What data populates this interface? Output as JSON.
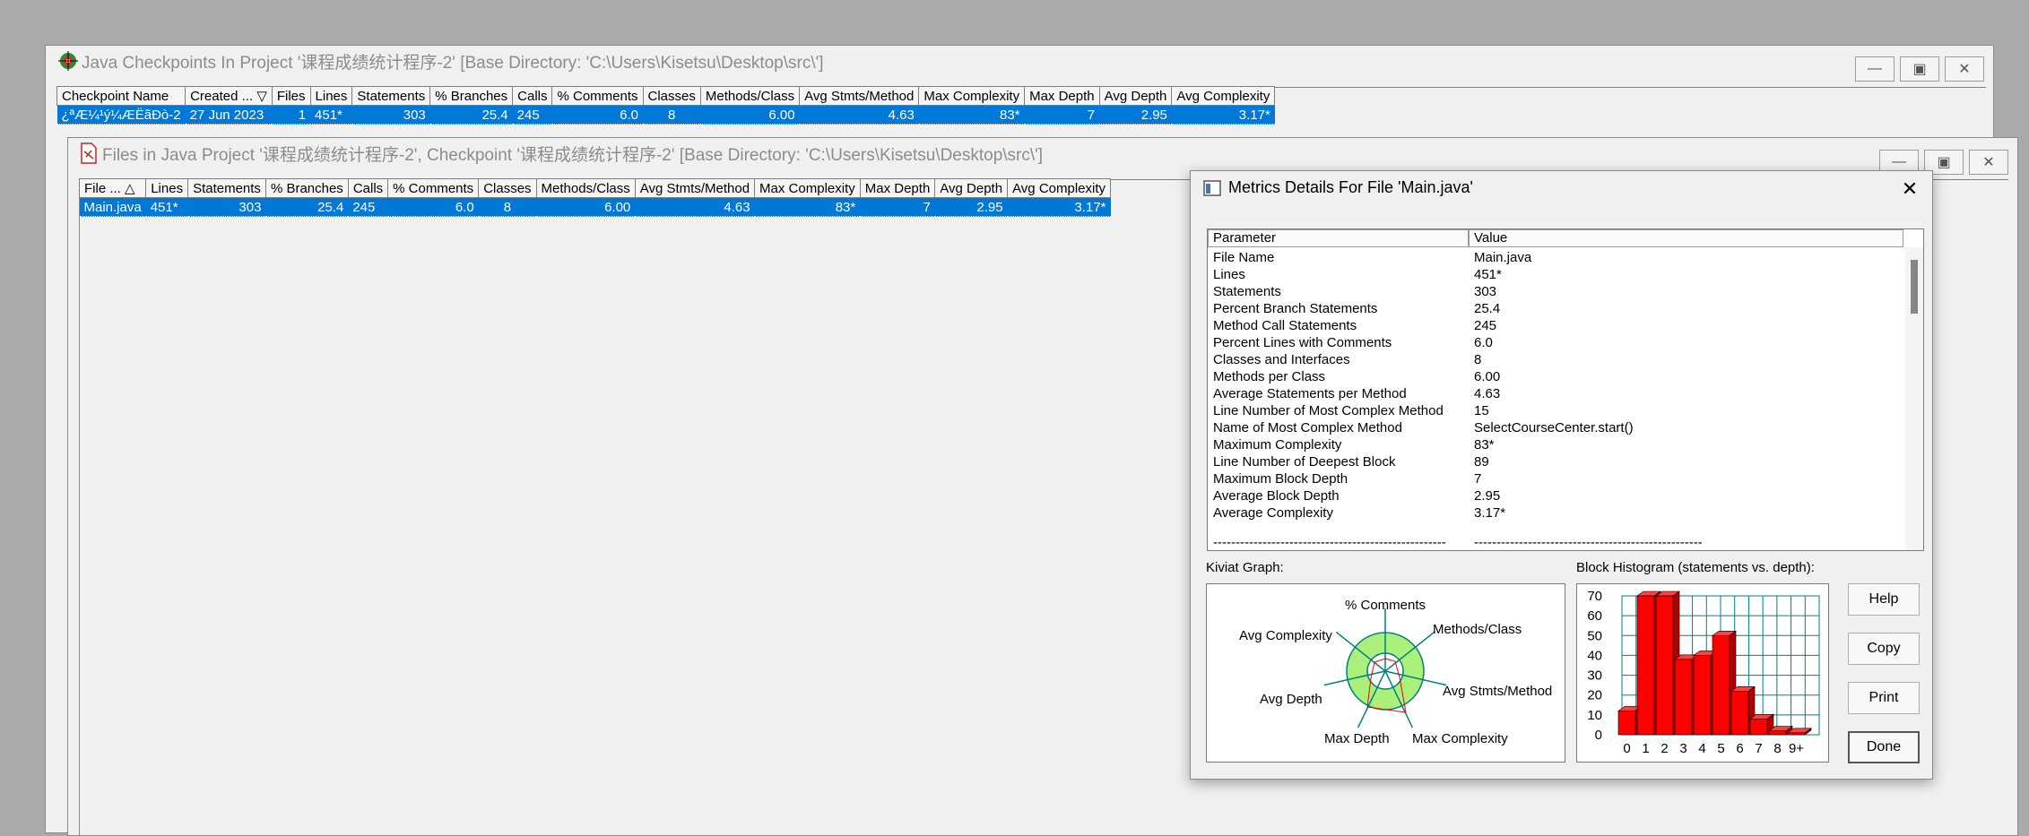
{
  "checkpoints_window": {
    "title": "Java Checkpoints In Project '课程成绩统计程序-2'  [Base Directory: 'C:\\Users\\Kisetsu\\Desktop\\src\\']",
    "columns": [
      "Checkpoint Name",
      "Created ...",
      "Files",
      "Lines",
      "Statements",
      "% Branches",
      "Calls",
      "% Comments",
      "Classes",
      "Methods/Class",
      "Avg Stmts/Method",
      "Max Complexity",
      "Max Depth",
      "Avg Depth",
      "Avg Complexity"
    ],
    "sort_indicator": "▽",
    "row": [
      "¿ªÆ¼¹ý¼ÆËãÐò-2",
      "27 Jun 2023",
      "1",
      "451*",
      "303",
      "25.4",
      "245",
      "6.0",
      "8",
      "6.00",
      "4.63",
      "83*",
      "7",
      "2.95",
      "3.17*"
    ]
  },
  "files_window": {
    "title": "Files in Java Project '课程成绩统计程序-2', Checkpoint '课程成绩统计程序-2'  [Base Directory: 'C:\\Users\\Kisetsu\\Desktop\\src\\']",
    "columns": [
      "File ...",
      "Lines",
      "Statements",
      "% Branches",
      "Calls",
      "% Comments",
      "Classes",
      "Methods/Class",
      "Avg Stmts/Method",
      "Max Complexity",
      "Max Depth",
      "Avg Depth",
      "Avg Complexity"
    ],
    "sort_indicator": "△",
    "row": [
      "Main.java",
      "451*",
      "303",
      "25.4",
      "245",
      "6.0",
      "8",
      "6.00",
      "4.63",
      "83*",
      "7",
      "2.95",
      "3.17*"
    ]
  },
  "dialog": {
    "title": "Metrics Details For File 'Main.java'",
    "close_glyph": "✕",
    "list_headers": [
      "Parameter",
      "Value"
    ],
    "metrics": [
      [
        "File Name",
        "Main.java"
      ],
      [
        "Lines",
        "451*"
      ],
      [
        "Statements",
        "303"
      ],
      [
        "Percent Branch Statements",
        "25.4"
      ],
      [
        "Method Call Statements",
        "245"
      ],
      [
        "Percent Lines with Comments",
        "6.0"
      ],
      [
        "Classes and Interfaces",
        "8"
      ],
      [
        "Methods per Class",
        "6.00"
      ],
      [
        "Average Statements per Method",
        "4.63"
      ],
      [
        "Line Number of Most Complex Method",
        "15"
      ],
      [
        "Name of Most Complex Method",
        "SelectCourseCenter.start()"
      ],
      [
        "Maximum Complexity",
        "83*"
      ],
      [
        "Line Number of Deepest Block",
        "89"
      ],
      [
        "Maximum Block Depth",
        "7"
      ],
      [
        "Average Block Depth",
        "2.95"
      ],
      [
        "Average Complexity",
        "3.17*"
      ]
    ],
    "separator_left": "----------------------------------------------------",
    "separator_right": "---------------------------------------------------",
    "kiviat_label": "Kiviat Graph:",
    "histogram_label": "Block Histogram (statements vs. depth):",
    "kiviat_axes": [
      "% Comments",
      "Methods/Class",
      "Avg Stmts/Method",
      "Max Complexity",
      "Max Depth",
      "Avg Depth",
      "Avg Complexity"
    ],
    "buttons": {
      "help": "Help",
      "copy": "Copy",
      "print": "Print",
      "done": "Done"
    }
  },
  "colors": {
    "selection": "#0078d7",
    "bar": "#ff0000",
    "ring": "#aaf07a",
    "grid": "#008080"
  },
  "chart_data": {
    "type": "bar",
    "categories": [
      "0",
      "1",
      "2",
      "3",
      "4",
      "5",
      "6",
      "7",
      "8",
      "9+"
    ],
    "values": [
      12,
      72,
      72,
      38,
      40,
      50,
      22,
      8,
      2,
      1
    ],
    "ylim": [
      0,
      70
    ],
    "yticks": [
      "0",
      "10",
      "20",
      "30",
      "40",
      "50",
      "60",
      "70"
    ],
    "xlabel": "",
    "ylabel": ""
  }
}
